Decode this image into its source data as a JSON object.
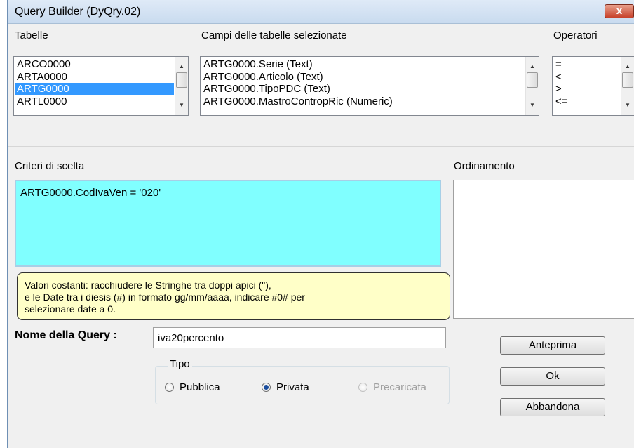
{
  "window": {
    "title": "Query Builder (DyQry.02)",
    "close_label": "x"
  },
  "tabelle": {
    "label": "Tabelle",
    "items": [
      "ARCO0000",
      "ARTA0000",
      "ARTG0000",
      "ARTL0000"
    ],
    "selected": "ARTG0000"
  },
  "campi": {
    "label": "Campi delle tabelle selezionate",
    "items": [
      "ARTG0000.Serie  (Text)",
      "ARTG0000.Articolo  (Text)",
      "ARTG0000.TipoPDC  (Text)",
      "ARTG0000.MastroContropRic  (Numeric)"
    ]
  },
  "operatori": {
    "label": "Operatori",
    "items": [
      "=",
      "<",
      ">",
      "<="
    ]
  },
  "criteri": {
    "label": "Criteri di scelta",
    "value": "ARTG0000.CodIvaVen = '020'",
    "bg_color": "#80ffff"
  },
  "ordinamento": {
    "label": "Ordinamento"
  },
  "note": {
    "lines": [
      "Valori costanti: racchiudere le Stringhe tra doppi apici (\"),",
      "e le Date tra i diesis (#) in formato gg/mm/aaaa, indicare #0# per",
      "selezionare date a 0."
    ]
  },
  "query_name": {
    "label": "Nome della Query :",
    "value": "iva20percento"
  },
  "tipo": {
    "label": "Tipo",
    "options": [
      {
        "label": "Pubblica",
        "checked": false,
        "enabled": true
      },
      {
        "label": "Privata",
        "checked": true,
        "enabled": true
      },
      {
        "label": "Precaricata",
        "checked": false,
        "enabled": false
      }
    ]
  },
  "buttons": {
    "preview": "Anteprima",
    "ok": "Ok",
    "cancel": "Abbandona"
  }
}
